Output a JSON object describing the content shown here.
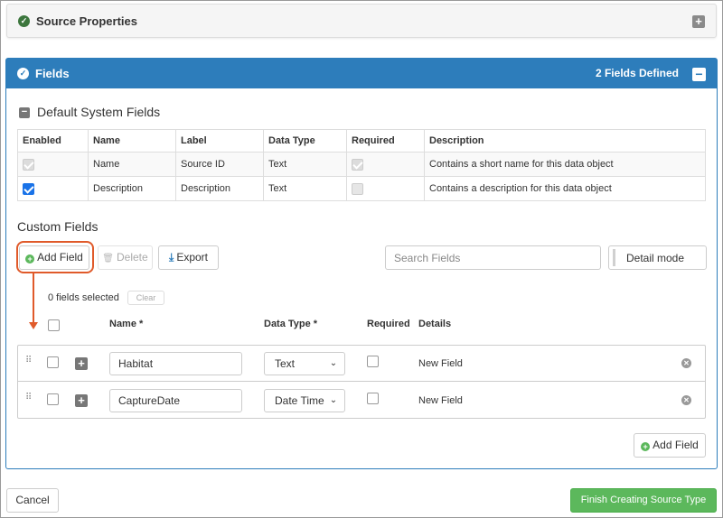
{
  "source_panel": {
    "title": "Source Properties",
    "check_icon": "check-circle-icon",
    "expand_icon": "plus-square-icon"
  },
  "fields_panel": {
    "title": "Fields",
    "fields_defined": "2 Fields Defined",
    "collapse_icon": "minus-square-icon",
    "header_color": "#2d7dbb"
  },
  "default_system_fields": {
    "title": "Default System Fields",
    "columns": [
      "Enabled",
      "Name",
      "Label",
      "Data Type",
      "Required",
      "Description"
    ],
    "rows": [
      {
        "enabled": true,
        "enabled_disabled": true,
        "name": "Name",
        "label": "Source ID",
        "data_type": "Text",
        "required": true,
        "required_disabled": true,
        "description": "Contains a short name for this data object"
      },
      {
        "enabled": true,
        "enabled_disabled": false,
        "name": "Description",
        "label": "Description",
        "data_type": "Text",
        "required": false,
        "required_disabled": true,
        "description": "Contains a description for this data object"
      }
    ]
  },
  "custom_fields": {
    "title": "Custom Fields",
    "toolbar": {
      "add_field": "Add Field",
      "delete": "Delete",
      "export": "Export",
      "search_placeholder": "Search Fields",
      "detail_mode": "Detail mode"
    },
    "selection": {
      "count_text": "0 fields selected",
      "clear": "Clear"
    },
    "columns": {
      "name": "Name *",
      "data_type": "Data Type *",
      "required": "Required",
      "details": "Details"
    },
    "rows": [
      {
        "name": "Habitat",
        "data_type": "Text",
        "required": false,
        "details": "New Field"
      },
      {
        "name": "CaptureDate",
        "data_type": "Date Time",
        "required": false,
        "details": "New Field"
      }
    ],
    "add_field_bottom": "Add Field"
  },
  "footer": {
    "cancel": "Cancel",
    "finish": "Finish Creating Source Type"
  },
  "accent": {
    "highlight": "#e05a2a",
    "success": "#5cb85c"
  }
}
